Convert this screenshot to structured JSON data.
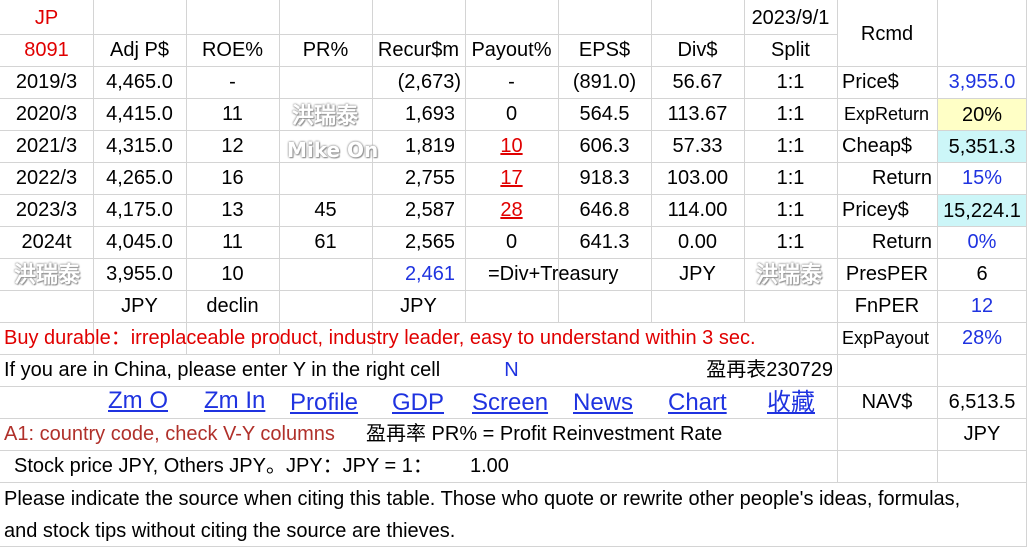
{
  "header": {
    "country": "JP",
    "code": "8091",
    "date": "2023/9/1",
    "cols": [
      "Adj P$",
      "ROE%",
      "PR%",
      "Recur$m",
      "Payout%",
      "EPS$",
      "Div$",
      "Split",
      "Rcmd"
    ]
  },
  "rows": [
    {
      "year": "2019/3",
      "adj": "4,465.0",
      "roe": "-",
      "pr": "",
      "recur": "(2,673)",
      "payout": "-",
      "eps": "(891.0)",
      "div": "56.67",
      "split": "1:1"
    },
    {
      "year": "2020/3",
      "adj": "4,415.0",
      "roe": "11",
      "pr": "",
      "recur": "1,693",
      "payout": "0",
      "eps": "564.5",
      "div": "113.67",
      "split": "1:1"
    },
    {
      "year": "2021/3",
      "adj": "4,315.0",
      "roe": "12",
      "pr": "",
      "recur": "1,819",
      "payout": "10",
      "eps": "606.3",
      "div": "57.33",
      "split": "1:1"
    },
    {
      "year": "2022/3",
      "adj": "4,265.0",
      "roe": "16",
      "pr": "",
      "recur": "2,755",
      "payout": "17",
      "eps": "918.3",
      "div": "103.00",
      "split": "1:1"
    },
    {
      "year": "2023/3",
      "adj": "4,175.0",
      "roe": "13",
      "pr": "45",
      "recur": "2,587",
      "payout": "28",
      "eps": "646.8",
      "div": "114.00",
      "split": "1:1"
    },
    {
      "year": "2024t",
      "adj": "4,045.0",
      "roe": "11",
      "pr": "61",
      "recur": "2,565",
      "payout": "0",
      "eps": "641.3",
      "div": "0.00",
      "split": "1:1"
    }
  ],
  "summary": {
    "adj": "3,955.0",
    "roe": "10",
    "recur": "2,461",
    "payout_note": "=Div+Treasury",
    "div_unit": "JPY",
    "unit_adj": "JPY",
    "unit_roe": "declin",
    "unit_recur": "JPY"
  },
  "rcmd": [
    {
      "label": "Price$",
      "value": "3,955.0"
    },
    {
      "label": "ExpReturn",
      "value": "20%"
    },
    {
      "label": "Cheap$",
      "value": "5,351.3"
    },
    {
      "label": "Return",
      "value": "15%"
    },
    {
      "label": "Pricey$",
      "value": "15,224.1"
    },
    {
      "label": "Return",
      "value": "0%"
    },
    {
      "label": "PresPER",
      "value": "6"
    },
    {
      "label": "FnPER",
      "value": "12"
    },
    {
      "label": "ExpPayout",
      "value": "28%"
    }
  ],
  "notes": {
    "buy_line": "Buy durable：irreplaceable product, industry leader, easy to understand within 3 sec.",
    "china_line": "If you are in China, please enter Y in the right cell",
    "china_value": "N",
    "table_id": "盈再表230729",
    "links": [
      "Zm O",
      "Zm In",
      "Profile",
      "GDP",
      "Screen",
      "News",
      "Chart",
      "收藏"
    ],
    "nav_label": "NAV$",
    "nav_value": "6,513.5",
    "a1_line": "A1: country code, check V-Y columns",
    "pr_def": "盈再率 PR% = Profit Reinvestment Rate",
    "currency": "JPY",
    "stock_line": "Stock price JPY, Others JPY。JPY：JPY = 1：",
    "rate": "1.00",
    "cite_1": "Please indicate the source when citing this table. Those who quote or rewrite other people's ideas, formulas,",
    "cite_2": "and stock tips without citing the source are thieves."
  },
  "watermarks": [
    "洪瑞泰",
    "Mike On"
  ],
  "colors": {
    "red": "#e00000",
    "blue": "#1f33e0",
    "yellow": "#ffffc6",
    "cyan": "#ccf6f8"
  }
}
